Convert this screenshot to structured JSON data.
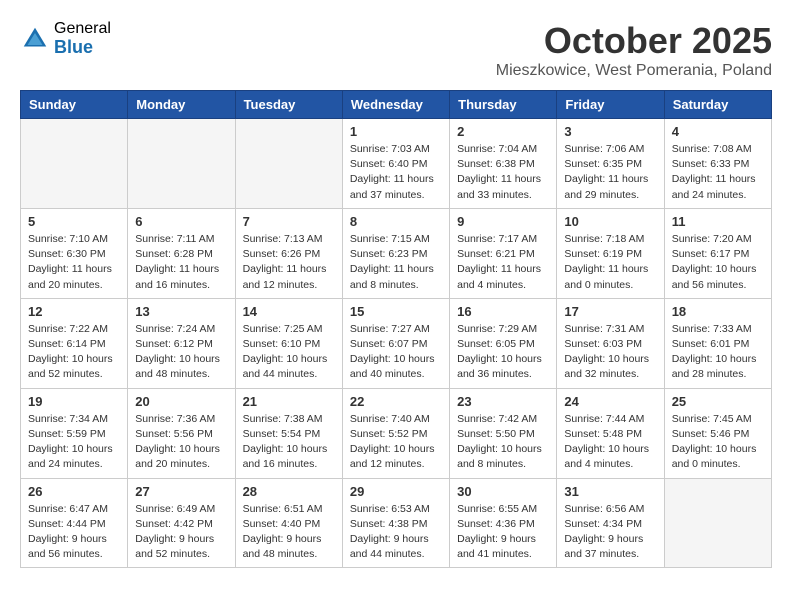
{
  "header": {
    "logo_general": "General",
    "logo_blue": "Blue",
    "month_title": "October 2025",
    "location": "Mieszkowice, West Pomerania, Poland"
  },
  "weekdays": [
    "Sunday",
    "Monday",
    "Tuesday",
    "Wednesday",
    "Thursday",
    "Friday",
    "Saturday"
  ],
  "weeks": [
    [
      {
        "day": "",
        "info": ""
      },
      {
        "day": "",
        "info": ""
      },
      {
        "day": "",
        "info": ""
      },
      {
        "day": "1",
        "info": "Sunrise: 7:03 AM\nSunset: 6:40 PM\nDaylight: 11 hours\nand 37 minutes."
      },
      {
        "day": "2",
        "info": "Sunrise: 7:04 AM\nSunset: 6:38 PM\nDaylight: 11 hours\nand 33 minutes."
      },
      {
        "day": "3",
        "info": "Sunrise: 7:06 AM\nSunset: 6:35 PM\nDaylight: 11 hours\nand 29 minutes."
      },
      {
        "day": "4",
        "info": "Sunrise: 7:08 AM\nSunset: 6:33 PM\nDaylight: 11 hours\nand 24 minutes."
      }
    ],
    [
      {
        "day": "5",
        "info": "Sunrise: 7:10 AM\nSunset: 6:30 PM\nDaylight: 11 hours\nand 20 minutes."
      },
      {
        "day": "6",
        "info": "Sunrise: 7:11 AM\nSunset: 6:28 PM\nDaylight: 11 hours\nand 16 minutes."
      },
      {
        "day": "7",
        "info": "Sunrise: 7:13 AM\nSunset: 6:26 PM\nDaylight: 11 hours\nand 12 minutes."
      },
      {
        "day": "8",
        "info": "Sunrise: 7:15 AM\nSunset: 6:23 PM\nDaylight: 11 hours\nand 8 minutes."
      },
      {
        "day": "9",
        "info": "Sunrise: 7:17 AM\nSunset: 6:21 PM\nDaylight: 11 hours\nand 4 minutes."
      },
      {
        "day": "10",
        "info": "Sunrise: 7:18 AM\nSunset: 6:19 PM\nDaylight: 11 hours\nand 0 minutes."
      },
      {
        "day": "11",
        "info": "Sunrise: 7:20 AM\nSunset: 6:17 PM\nDaylight: 10 hours\nand 56 minutes."
      }
    ],
    [
      {
        "day": "12",
        "info": "Sunrise: 7:22 AM\nSunset: 6:14 PM\nDaylight: 10 hours\nand 52 minutes."
      },
      {
        "day": "13",
        "info": "Sunrise: 7:24 AM\nSunset: 6:12 PM\nDaylight: 10 hours\nand 48 minutes."
      },
      {
        "day": "14",
        "info": "Sunrise: 7:25 AM\nSunset: 6:10 PM\nDaylight: 10 hours\nand 44 minutes."
      },
      {
        "day": "15",
        "info": "Sunrise: 7:27 AM\nSunset: 6:07 PM\nDaylight: 10 hours\nand 40 minutes."
      },
      {
        "day": "16",
        "info": "Sunrise: 7:29 AM\nSunset: 6:05 PM\nDaylight: 10 hours\nand 36 minutes."
      },
      {
        "day": "17",
        "info": "Sunrise: 7:31 AM\nSunset: 6:03 PM\nDaylight: 10 hours\nand 32 minutes."
      },
      {
        "day": "18",
        "info": "Sunrise: 7:33 AM\nSunset: 6:01 PM\nDaylight: 10 hours\nand 28 minutes."
      }
    ],
    [
      {
        "day": "19",
        "info": "Sunrise: 7:34 AM\nSunset: 5:59 PM\nDaylight: 10 hours\nand 24 minutes."
      },
      {
        "day": "20",
        "info": "Sunrise: 7:36 AM\nSunset: 5:56 PM\nDaylight: 10 hours\nand 20 minutes."
      },
      {
        "day": "21",
        "info": "Sunrise: 7:38 AM\nSunset: 5:54 PM\nDaylight: 10 hours\nand 16 minutes."
      },
      {
        "day": "22",
        "info": "Sunrise: 7:40 AM\nSunset: 5:52 PM\nDaylight: 10 hours\nand 12 minutes."
      },
      {
        "day": "23",
        "info": "Sunrise: 7:42 AM\nSunset: 5:50 PM\nDaylight: 10 hours\nand 8 minutes."
      },
      {
        "day": "24",
        "info": "Sunrise: 7:44 AM\nSunset: 5:48 PM\nDaylight: 10 hours\nand 4 minutes."
      },
      {
        "day": "25",
        "info": "Sunrise: 7:45 AM\nSunset: 5:46 PM\nDaylight: 10 hours\nand 0 minutes."
      }
    ],
    [
      {
        "day": "26",
        "info": "Sunrise: 6:47 AM\nSunset: 4:44 PM\nDaylight: 9 hours\nand 56 minutes."
      },
      {
        "day": "27",
        "info": "Sunrise: 6:49 AM\nSunset: 4:42 PM\nDaylight: 9 hours\nand 52 minutes."
      },
      {
        "day": "28",
        "info": "Sunrise: 6:51 AM\nSunset: 4:40 PM\nDaylight: 9 hours\nand 48 minutes."
      },
      {
        "day": "29",
        "info": "Sunrise: 6:53 AM\nSunset: 4:38 PM\nDaylight: 9 hours\nand 44 minutes."
      },
      {
        "day": "30",
        "info": "Sunrise: 6:55 AM\nSunset: 4:36 PM\nDaylight: 9 hours\nand 41 minutes."
      },
      {
        "day": "31",
        "info": "Sunrise: 6:56 AM\nSunset: 4:34 PM\nDaylight: 9 hours\nand 37 minutes."
      },
      {
        "day": "",
        "info": ""
      }
    ]
  ]
}
